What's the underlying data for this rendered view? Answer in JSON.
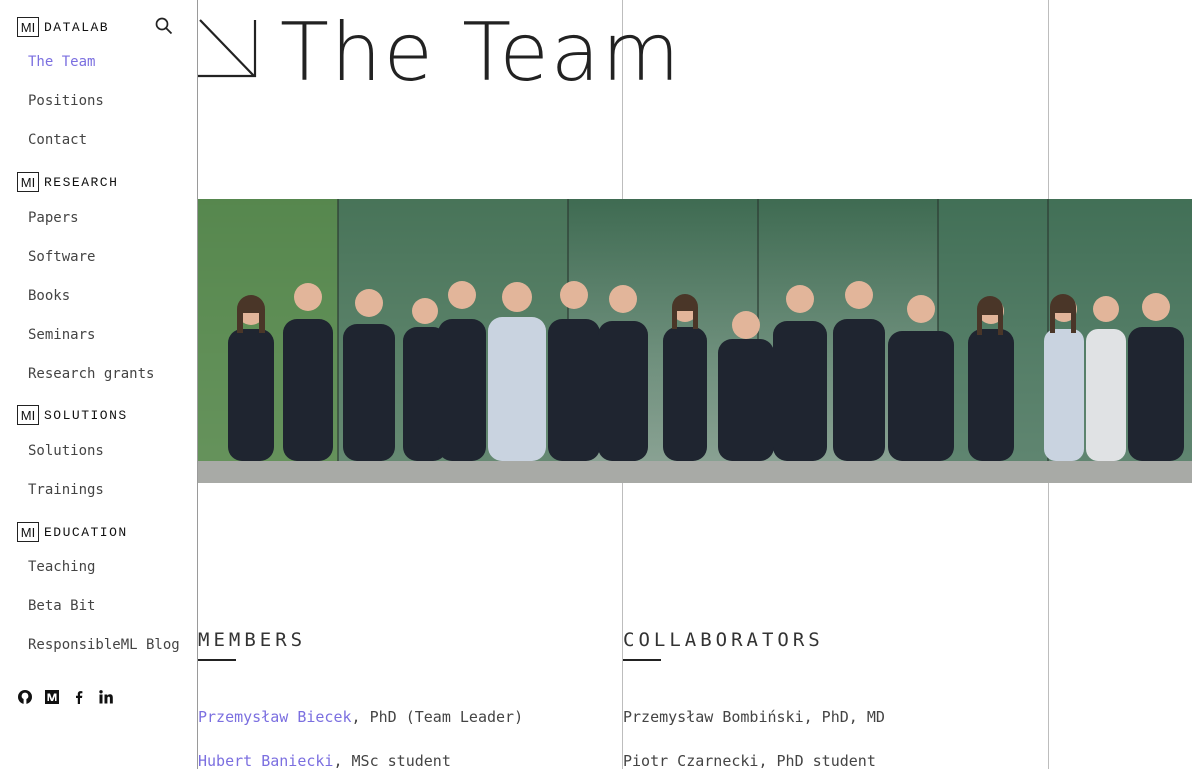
{
  "sidebar": {
    "sections": [
      {
        "badge": "MI",
        "label": "DATALAB",
        "items": [
          {
            "label": "The Team",
            "active": true
          },
          {
            "label": "Positions"
          },
          {
            "label": "Contact"
          }
        ]
      },
      {
        "badge": "MI",
        "label": "RESEARCH",
        "items": [
          {
            "label": "Papers"
          },
          {
            "label": "Software"
          },
          {
            "label": "Books"
          },
          {
            "label": "Seminars"
          },
          {
            "label": "Research grants"
          }
        ]
      },
      {
        "badge": "MI",
        "label": "SOLUTIONS",
        "items": [
          {
            "label": "Solutions"
          },
          {
            "label": "Trainings"
          }
        ]
      },
      {
        "badge": "MI",
        "label": "EDUCATION",
        "items": [
          {
            "label": "Teaching"
          },
          {
            "label": "Beta Bit"
          },
          {
            "label": "ResponsibleML Blog"
          }
        ]
      }
    ],
    "socials": [
      "github-icon",
      "medium-icon",
      "facebook-icon",
      "linkedin-icon"
    ]
  },
  "page": {
    "title": "The Team",
    "accent_color": "#7b6fe0"
  },
  "members": {
    "heading": "MEMBERS",
    "list": [
      {
        "name": "Przemysław Biecek",
        "rest": ", PhD (Team Leader)"
      },
      {
        "name": "Hubert Baniecki",
        "rest": ", MSc student"
      }
    ]
  },
  "collaborators": {
    "heading": "COLLABORATORS",
    "list": [
      {
        "text": "Przemysław Bombiński, PhD, MD"
      },
      {
        "text": "Piotr Czarnecki, PhD student"
      }
    ]
  }
}
